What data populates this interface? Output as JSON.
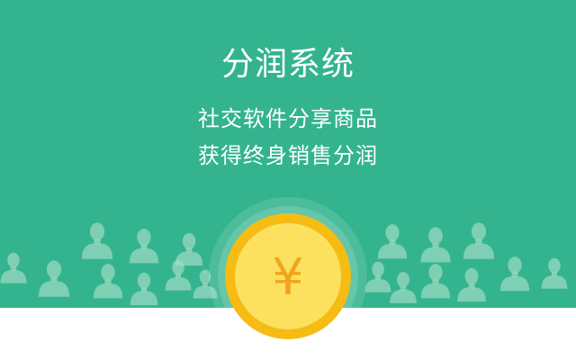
{
  "banner": {
    "title": "分润系统",
    "taglines": [
      "社交软件分享商品",
      "获得终身销售分润"
    ]
  },
  "coin": {
    "symbol": "¥",
    "icon": "yen-coin-icon"
  },
  "crowd": {
    "icon": "person-silhouette-icon"
  },
  "colors": {
    "banner_green": "#34b48e",
    "coin_yellow": "#fbe15e",
    "coin_ring": "#f6bc14",
    "coin_symbol": "#f1a41c",
    "footer_white": "#ffffff"
  }
}
